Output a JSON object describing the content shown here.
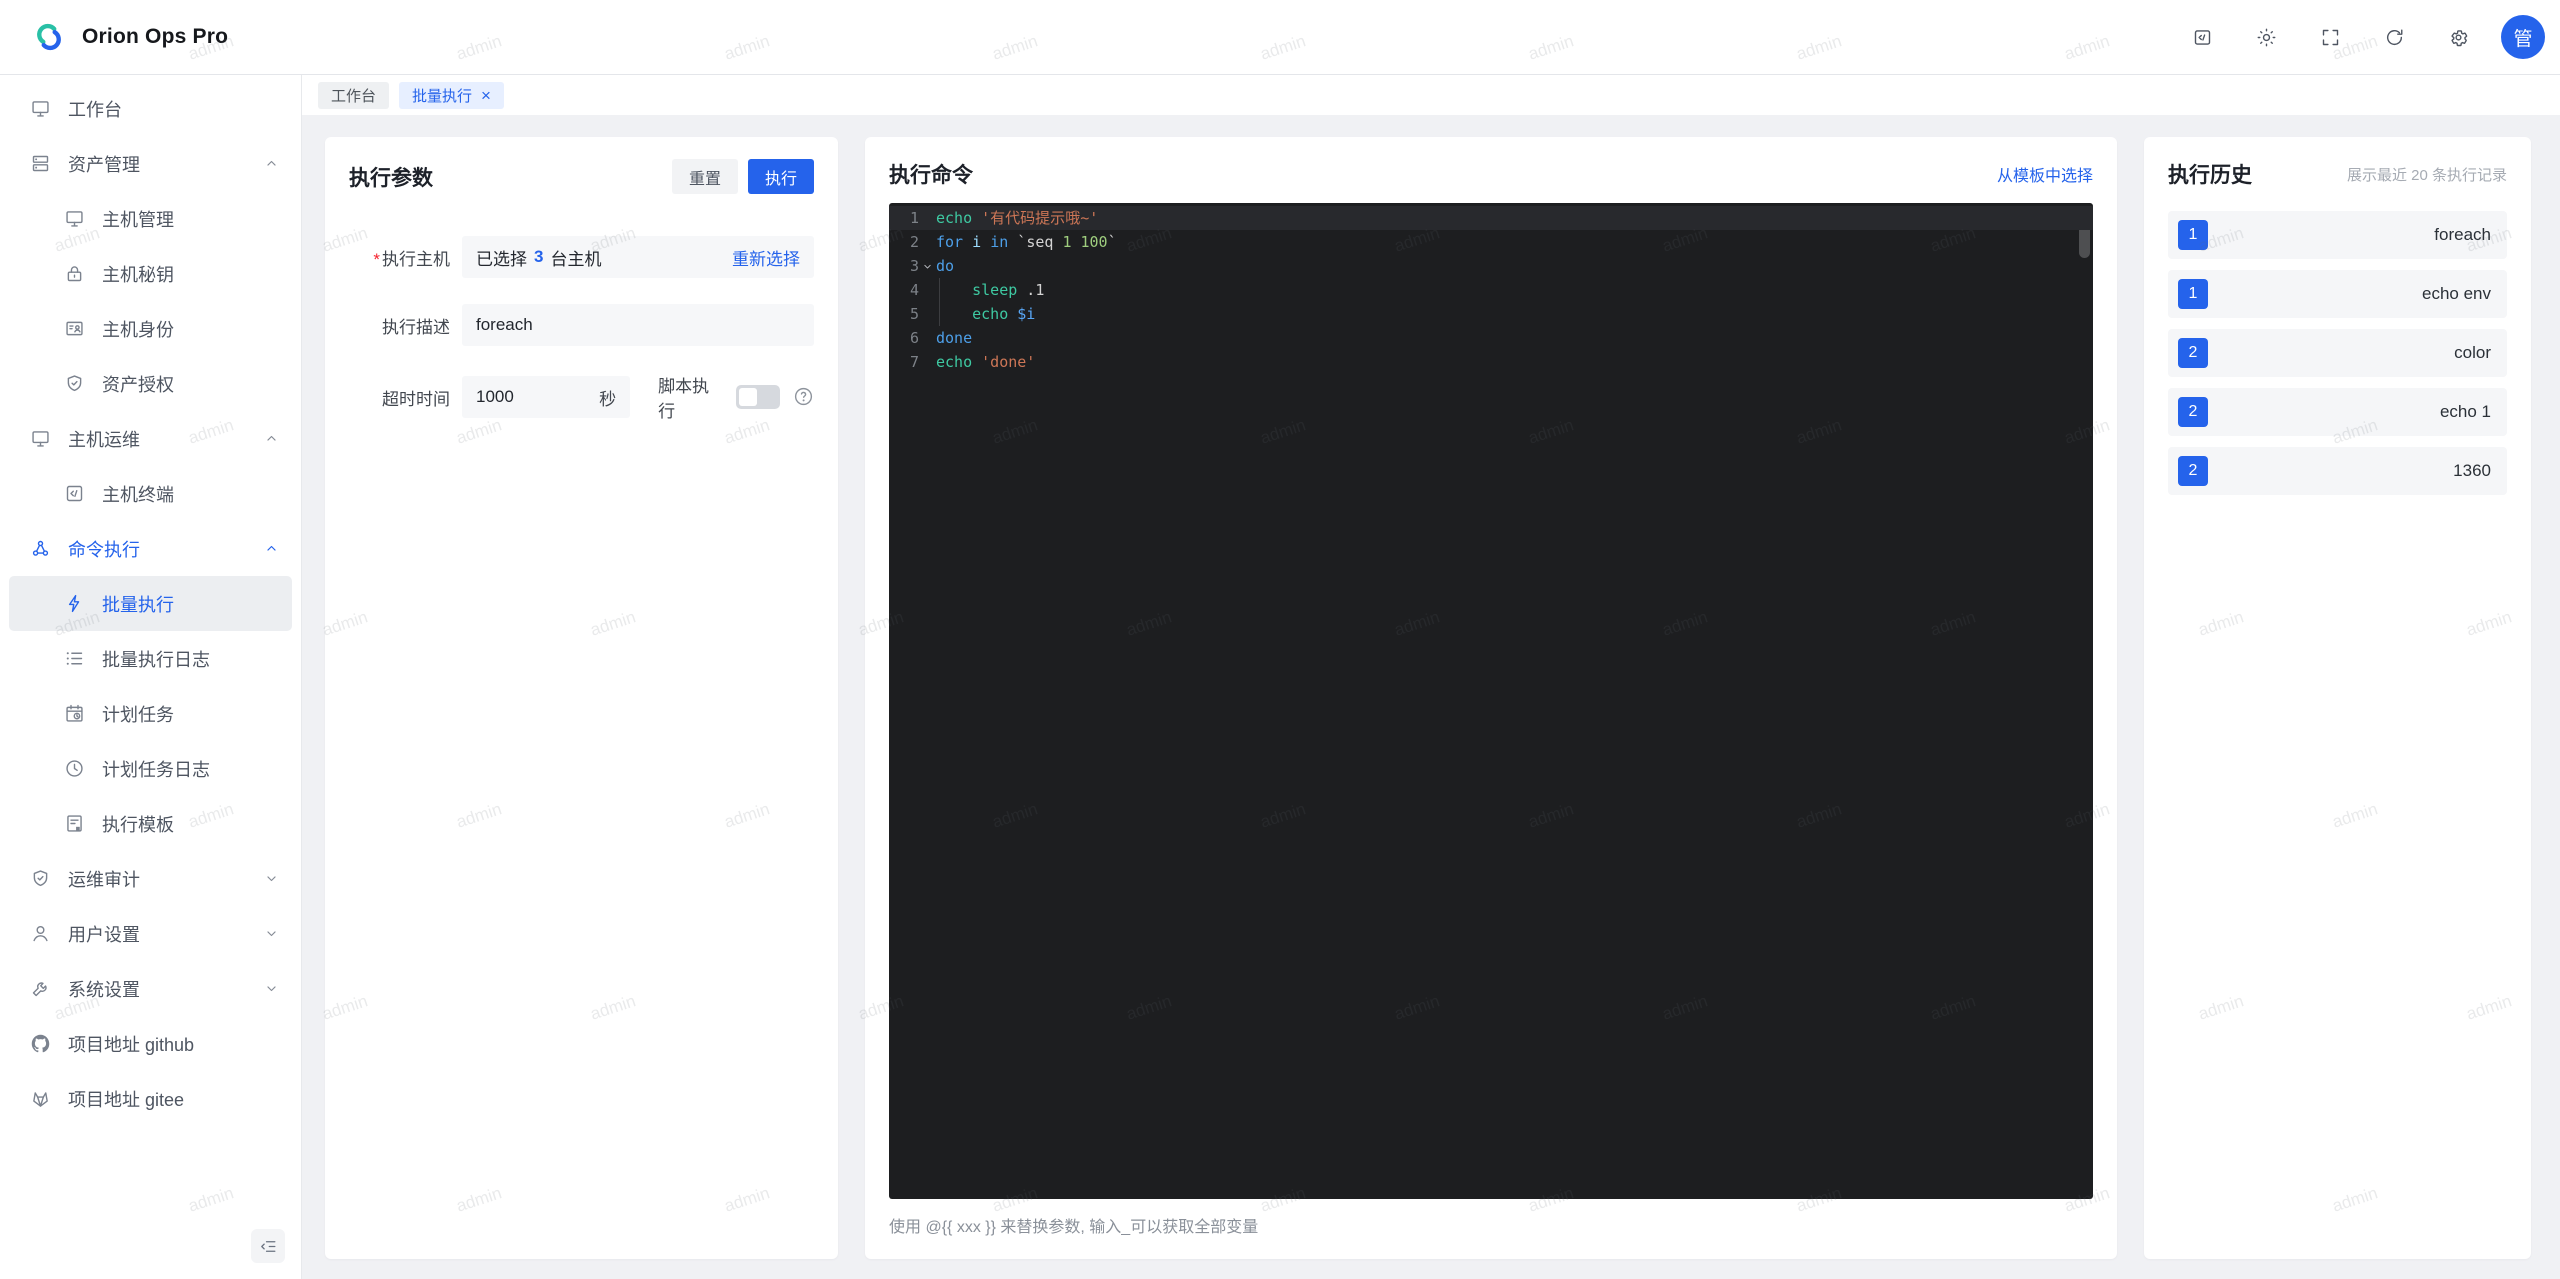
{
  "app": {
    "title": "Orion Ops Pro",
    "avatar": "管"
  },
  "header": {
    "icons": [
      {
        "name": "dev-terminal-icon",
        "icon": "codebox"
      },
      {
        "name": "theme-icon",
        "icon": "sun"
      },
      {
        "name": "fullscreen-icon",
        "icon": "fullscreen"
      },
      {
        "name": "refresh-icon",
        "icon": "refresh"
      },
      {
        "name": "settings-icon",
        "icon": "gear"
      }
    ]
  },
  "sidebar": {
    "items": [
      {
        "name": "workbench",
        "label": "工作台",
        "icon": "monitor",
        "level": 1
      },
      {
        "name": "asset-management",
        "label": "资产管理",
        "icon": "servers",
        "level": 1,
        "chevron": "up"
      },
      {
        "name": "host-management",
        "label": "主机管理",
        "icon": "monitor",
        "level": 2
      },
      {
        "name": "host-keys",
        "label": "主机秘钥",
        "icon": "lock",
        "level": 2
      },
      {
        "name": "host-identity",
        "label": "主机身份",
        "icon": "idcard",
        "level": 2
      },
      {
        "name": "asset-authorization",
        "label": "资产授权",
        "icon": "shield",
        "level": 2
      },
      {
        "name": "host-ops",
        "label": "主机运维",
        "icon": "monitor",
        "level": 1,
        "chevron": "up"
      },
      {
        "name": "host-terminal",
        "label": "主机终端",
        "icon": "terminal",
        "level": 2
      },
      {
        "name": "command-execution",
        "label": "命令执行",
        "icon": "cluster",
        "level": 1,
        "chevron": "up",
        "parentActive": true
      },
      {
        "name": "batch-execution",
        "label": "批量执行",
        "icon": "lightning",
        "level": 2,
        "selected": true
      },
      {
        "name": "batch-execution-log",
        "label": "批量执行日志",
        "icon": "listlog",
        "level": 2
      },
      {
        "name": "scheduled-tasks",
        "label": "计划任务",
        "icon": "calendar",
        "level": 2
      },
      {
        "name": "scheduled-task-log",
        "label": "计划任务日志",
        "icon": "clock",
        "level": 2
      },
      {
        "name": "execution-template",
        "label": "执行模板",
        "icon": "template",
        "level": 2
      },
      {
        "name": "ops-audit",
        "label": "运维审计",
        "icon": "shield",
        "level": 1,
        "chevron": "down"
      },
      {
        "name": "user-settings",
        "label": "用户设置",
        "icon": "user",
        "level": 1,
        "chevron": "down"
      },
      {
        "name": "system-settings",
        "label": "系统设置",
        "icon": "wrench",
        "level": 1,
        "chevron": "down"
      },
      {
        "name": "project-github",
        "label": "项目地址 github",
        "icon": "github",
        "level": 1
      },
      {
        "name": "project-gitee",
        "label": "项目地址 gitee",
        "icon": "gitee",
        "level": 1
      }
    ]
  },
  "tabs": [
    {
      "name": "tab-workbench",
      "label": "工作台",
      "active": false,
      "closable": false
    },
    {
      "name": "tab-batch-execution",
      "label": "批量执行",
      "active": true,
      "closable": true,
      "close_glyph": "×"
    }
  ],
  "params": {
    "title": "执行参数",
    "reset": "重置",
    "execute": "执行",
    "host": {
      "label": "执行主机",
      "required": true,
      "prefix": "已选择",
      "count": "3",
      "suffix": "台主机",
      "action": "重新选择"
    },
    "desc": {
      "label": "执行描述",
      "value": "foreach"
    },
    "timeout": {
      "label": "超时时间",
      "value": "1000",
      "unit": "秒"
    },
    "script": {
      "label": "脚本执行",
      "enabled": false
    }
  },
  "command": {
    "title": "执行命令",
    "template_link": "从模板中选择",
    "hint": "使用 @{{ xxx }} 来替换参数, 输入_可以获取全部变量",
    "code_lines": [
      {
        "num": "1",
        "active": true,
        "tokens": [
          {
            "t": "echo",
            "c": "cmd"
          },
          {
            "t": " ",
            "c": "pln"
          },
          {
            "t": "'有代码提示哦~'",
            "c": "str"
          }
        ]
      },
      {
        "num": "2",
        "tokens": [
          {
            "t": "for",
            "c": "kw"
          },
          {
            "t": " ",
            "c": "pln"
          },
          {
            "t": "i",
            "c": "param"
          },
          {
            "t": " ",
            "c": "pln"
          },
          {
            "t": "in",
            "c": "kw"
          },
          {
            "t": " `",
            "c": "pln"
          },
          {
            "t": "seq",
            "c": "pln"
          },
          {
            "t": " ",
            "c": "pln"
          },
          {
            "t": "1 100",
            "c": "num"
          },
          {
            "t": "`",
            "c": "pln"
          }
        ]
      },
      {
        "num": "3",
        "fold": true,
        "tokens": [
          {
            "t": "do",
            "c": "kw"
          }
        ]
      },
      {
        "num": "4",
        "guide": true,
        "tokens": [
          {
            "t": "    ",
            "c": "pln"
          },
          {
            "t": "sleep",
            "c": "cmd"
          },
          {
            "t": " .1",
            "c": "pln"
          }
        ]
      },
      {
        "num": "5",
        "guide": true,
        "tokens": [
          {
            "t": "    ",
            "c": "pln"
          },
          {
            "t": "echo",
            "c": "cmd"
          },
          {
            "t": " ",
            "c": "pln"
          },
          {
            "t": "$i",
            "c": "var"
          }
        ]
      },
      {
        "num": "6",
        "tokens": [
          {
            "t": "done",
            "c": "kw"
          }
        ]
      },
      {
        "num": "7",
        "tokens": [
          {
            "t": "echo",
            "c": "cmd"
          },
          {
            "t": " ",
            "c": "pln"
          },
          {
            "t": "'done'",
            "c": "str"
          }
        ]
      }
    ]
  },
  "history": {
    "title": "执行历史",
    "subtitle": "展示最近 20 条执行记录",
    "items": [
      {
        "badge": "1",
        "label": "foreach"
      },
      {
        "badge": "1",
        "label": "echo env"
      },
      {
        "badge": "2",
        "label": "color"
      },
      {
        "badge": "2",
        "label": "echo 1"
      },
      {
        "badge": "2",
        "label": "1360"
      }
    ]
  },
  "watermark": {
    "text": "admin"
  },
  "colors": {
    "primary": "#2563eb",
    "brand_teal": "#29c0a6",
    "editor_bg": "#1d1e20",
    "token_command": "#3ec9a2",
    "token_keyword": "#4d9fe8",
    "token_string": "#cd7656",
    "token_number": "#9fce7e",
    "token_variable": "#58a6f5"
  }
}
